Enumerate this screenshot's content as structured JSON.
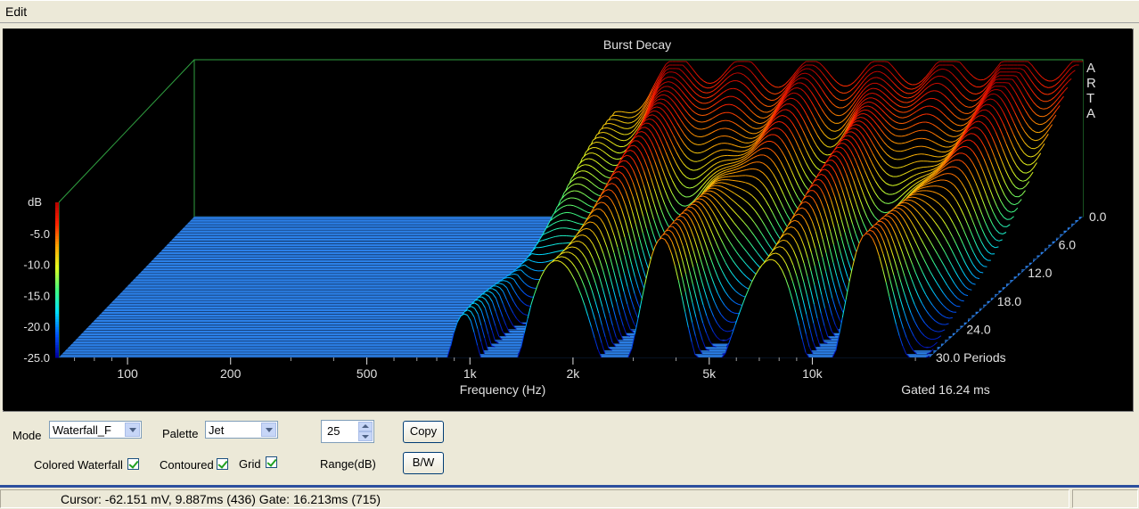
{
  "menu": {
    "edit": "Edit"
  },
  "chart_data": {
    "type": "waterfall",
    "title": "Burst Decay",
    "xlabel": "Frequency (Hz)",
    "x_scale": "log",
    "x_ticks": [
      "100",
      "200",
      "500",
      "1k",
      "2k",
      "5k",
      "10k"
    ],
    "z_label": "dB",
    "z_ticks": [
      "-5.0",
      "-10.0",
      "-15.0",
      "-20.0",
      "-25.0"
    ],
    "z_range": [
      -25,
      0
    ],
    "depth_ticks": [
      "0.0",
      "6.0",
      "12.0",
      "18.0",
      "24.0",
      "30.0 Periods"
    ],
    "depth_range": [
      0,
      30
    ],
    "watermark": "ARTA",
    "gate_label": "Gated 16.24 ms",
    "palette_colors": [
      "#0000a0",
      "#0055ff",
      "#00e0ff",
      "#40ff80",
      "#e0ff20",
      "#ffa000",
      "#ff2000",
      "#b00000"
    ],
    "floor_color": "#2b80e8",
    "frame_color": "#2fa040",
    "series": [
      {
        "name": "0",
        "values": [
          [
            800,
            -24
          ],
          [
            1000,
            -10
          ],
          [
            1300,
            -3
          ],
          [
            1500,
            -1
          ],
          [
            3000,
            -2
          ],
          [
            8000,
            -1.5
          ],
          [
            13000,
            -0.5
          ],
          [
            18000,
            -1
          ]
        ]
      }
    ]
  },
  "controls": {
    "mode_label": "Mode",
    "mode_value": "Waterfall_F",
    "palette_label": "Palette",
    "palette_value": "Jet",
    "range_value": "25",
    "range_label": "Range(dB)",
    "copy_label": "Copy",
    "bw_label": "B/W",
    "colored_waterfall_label": "Colored Waterfall",
    "contoured_label": "Contoured",
    "grid_label": "Grid",
    "colored_waterfall_checked": true,
    "contoured_checked": true,
    "grid_checked": true
  },
  "status": {
    "text": "Cursor: -62.151 mV, 9.887ms (436)  Gate: 16.213ms (715)"
  }
}
